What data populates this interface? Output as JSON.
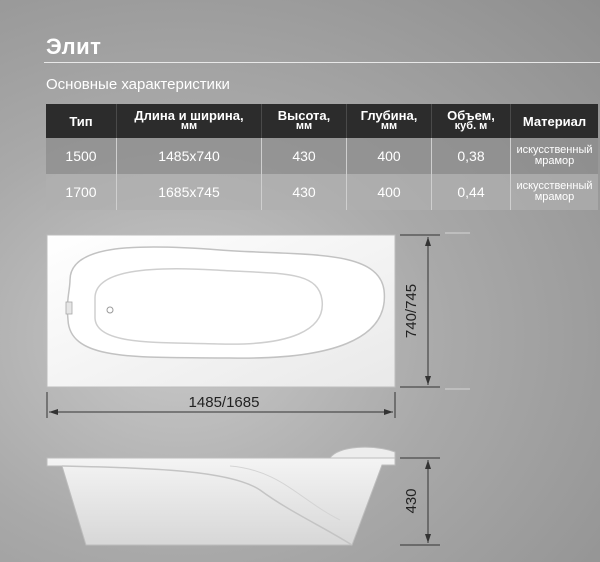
{
  "title": "Элит",
  "subtitle": "Основные характеристики",
  "table": {
    "headers": [
      {
        "main": "Тип",
        "sub": ""
      },
      {
        "main": "Длина и ширина,",
        "sub": "мм"
      },
      {
        "main": "Высота,",
        "sub": "мм"
      },
      {
        "main": "Глубина,",
        "sub": "мм"
      },
      {
        "main": "Объем,",
        "sub": "куб. м"
      },
      {
        "main": "Материал",
        "sub": ""
      }
    ],
    "rows": [
      {
        "type": "1500",
        "size": "1485x740",
        "height": "430",
        "depth": "400",
        "volume": "0,38",
        "material_1": "искусственный",
        "material_2": "мрамор"
      },
      {
        "type": "1700",
        "size": "1685x745",
        "height": "430",
        "depth": "400",
        "volume": "0,44",
        "material_1": "искусственный",
        "material_2": "мрамор"
      }
    ]
  },
  "dimensions": {
    "width_label": "740/745",
    "length_label": "1485/1685",
    "height_label": "430"
  }
}
